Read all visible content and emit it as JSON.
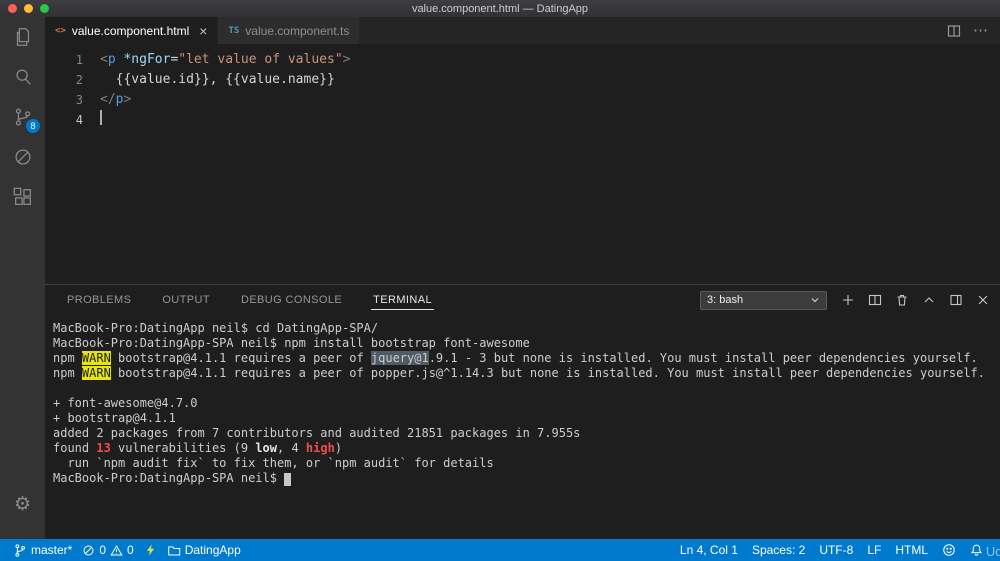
{
  "colors": {
    "accent": "#007acc",
    "warn-bg": "#e5e510",
    "term-red": "#f14c4c",
    "selection": "#4f5b66"
  },
  "titlebar": {
    "title": "value.component.html — DatingApp"
  },
  "activity_bar": {
    "source_control_badge": "8"
  },
  "tabs": [
    {
      "label": "value.component.html",
      "active": true
    },
    {
      "label": "value.component.ts",
      "active": false
    }
  ],
  "editor": {
    "lines": [
      {
        "num": "1",
        "tokens": [
          {
            "t": "<",
            "c": "p"
          },
          {
            "t": "p",
            "c": "tag"
          },
          {
            "t": " ",
            "c": "d"
          },
          {
            "t": "*ngFor",
            "c": "attr"
          },
          {
            "t": "=",
            "c": "d"
          },
          {
            "t": "\"let value of values\"",
            "c": "str"
          },
          {
            "t": ">",
            "c": "p"
          }
        ]
      },
      {
        "num": "2",
        "tokens": [
          {
            "t": "  {{value.id}}, {{value.name}}",
            "c": "d"
          }
        ]
      },
      {
        "num": "3",
        "tokens": [
          {
            "t": "</",
            "c": "p"
          },
          {
            "t": "p",
            "c": "tag"
          },
          {
            "t": ">",
            "c": "p"
          }
        ]
      },
      {
        "num": "4",
        "tokens": [],
        "cursor": true
      }
    ]
  },
  "panel": {
    "tabs": [
      {
        "label": "PROBLEMS",
        "active": false
      },
      {
        "label": "OUTPUT",
        "active": false
      },
      {
        "label": "DEBUG CONSOLE",
        "active": false
      },
      {
        "label": "TERMINAL",
        "active": true
      }
    ],
    "terminal_select": "3: bash"
  },
  "terminal": {
    "lines": [
      [
        {
          "t": "MacBook-Pro:DatingApp neil$ cd DatingApp-SPA/"
        }
      ],
      [
        {
          "t": "MacBook-Pro:DatingApp-SPA neil$ npm install bootstrap font-awesome"
        }
      ],
      [
        {
          "t": "npm "
        },
        {
          "t": "WARN",
          "c": "warn"
        },
        {
          "t": " bootstrap@4.1.1 requires a peer of "
        },
        {
          "t": "jquery@1",
          "c": "sel"
        },
        {
          "t": ".9.1 - 3 but none is installed. You must install peer dependencies yourself."
        }
      ],
      [
        {
          "t": "npm "
        },
        {
          "t": "WARN",
          "c": "warn"
        },
        {
          "t": " bootstrap@4.1.1 requires a peer of popper.js@^1.14.3 but none is installed. You must install peer dependencies yourself."
        }
      ],
      [],
      [
        {
          "t": "+ font-awesome@4.7.0"
        }
      ],
      [
        {
          "t": "+ bootstrap@4.1.1"
        }
      ],
      [
        {
          "t": "added 2 packages from 7 contributors and audited 21851 packages in 7.955s"
        }
      ],
      [
        {
          "t": "found "
        },
        {
          "t": "13",
          "c": "red"
        },
        {
          "t": " vulnerabilities (9 "
        },
        {
          "t": "low",
          "c": "b"
        },
        {
          "t": ", 4 "
        },
        {
          "t": "high",
          "c": "red"
        },
        {
          "t": ")"
        }
      ],
      [
        {
          "t": "  run `npm audit fix` to fix them, or `npm audit` for details"
        }
      ],
      [
        {
          "t": "MacBook-Pro:DatingApp-SPA neil$ "
        },
        {
          "t": " ",
          "c": "cursor"
        }
      ]
    ]
  },
  "status_bar": {
    "branch": "master*",
    "errors": "0",
    "warnings": "0",
    "project": "DatingApp",
    "line_col": "Ln 4, Col 1",
    "indent": "Spaces: 2",
    "encoding": "UTF-8",
    "eol": "LF",
    "language": "HTML"
  },
  "watermark": "Udemy"
}
